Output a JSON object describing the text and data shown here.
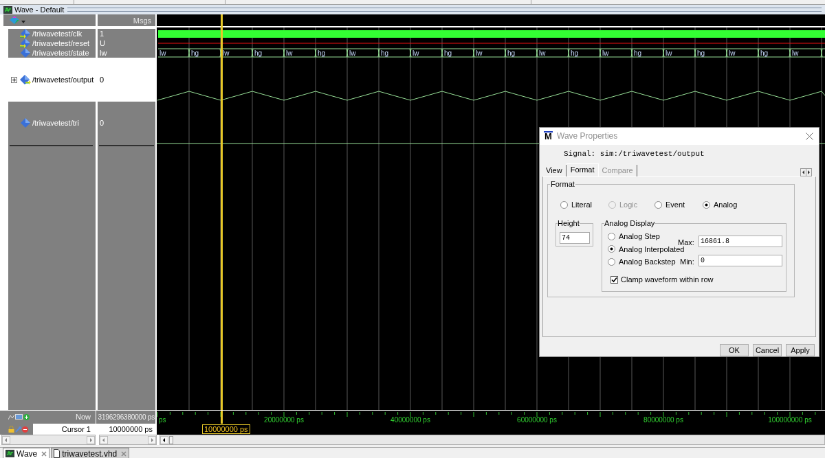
{
  "window": {
    "title": "Wave - Default"
  },
  "wave_pane": {
    "header": {
      "column_2": "Msgs"
    },
    "signals": [
      {
        "name": "/triwavetest/clk",
        "value": "1",
        "kind": "clock",
        "selected": false
      },
      {
        "name": "/triwavetest/reset",
        "value": "U",
        "kind": "unknown",
        "selected": false
      },
      {
        "name": "/triwavetest/state",
        "value": "lw",
        "kind": "bus",
        "selected": false,
        "segments": [
          "lw",
          "hg",
          "lw",
          "hg",
          "lw",
          "hg",
          "lw",
          "hg",
          "lw",
          "hg",
          "lw",
          "hg",
          "lw",
          "hg",
          "lw",
          "hg",
          "lw",
          "hg",
          "lw",
          "hg",
          "lw"
        ]
      },
      {
        "name": "/triwavetest/output",
        "value": "0",
        "kind": "analog",
        "selected": true,
        "expanded": false
      },
      {
        "name": "/triwavetest/tri",
        "value": "0",
        "kind": "analog_flat",
        "selected": false
      }
    ],
    "now": {
      "label": "Now",
      "value": "3196296380000 ps"
    },
    "cursor": {
      "label": "Cursor 1",
      "value": "10000000 ps",
      "marker": "10000000 ps"
    },
    "timeline": {
      "labels": [
        "ps",
        "20000000 ps",
        "40000000 ps",
        "60000000 ps",
        "80000000 ps",
        "100000000 ps"
      ]
    }
  },
  "document_tabs": [
    {
      "label": "Wave",
      "selected": true
    },
    {
      "label": "triwavetest.vhd",
      "selected": false
    }
  ],
  "dialog": {
    "logo": "M",
    "title": "Wave Properties",
    "signal": "Signal: sim:/triwavetest/output",
    "tabs": [
      {
        "label": "View",
        "selected": false,
        "disabled": false
      },
      {
        "label": "Format",
        "selected": true,
        "disabled": false
      },
      {
        "label": "Compare",
        "selected": false,
        "disabled": true
      }
    ],
    "format_group": {
      "title": "Format",
      "options": [
        {
          "label": "Literal",
          "selected": false,
          "disabled": false
        },
        {
          "label": "Logic",
          "selected": false,
          "disabled": true
        },
        {
          "label": "Event",
          "selected": false,
          "disabled": false
        },
        {
          "label": "Analog",
          "selected": true,
          "disabled": false
        }
      ]
    },
    "height": {
      "title": "Height",
      "value": "74"
    },
    "analog_display": {
      "title": "Analog Display",
      "options": [
        {
          "label": "Analog Step",
          "selected": false
        },
        {
          "label": "Analog Interpolated",
          "selected": true
        },
        {
          "label": "Analog Backstep",
          "selected": false
        }
      ],
      "max": {
        "label": "Max:",
        "value": "16861.8"
      },
      "min": {
        "label": "Min:",
        "value": "0"
      },
      "clamp": {
        "label": "Clamp waveform within row",
        "checked": true
      }
    },
    "buttons": [
      "OK",
      "Cancel",
      "Apply"
    ]
  }
}
